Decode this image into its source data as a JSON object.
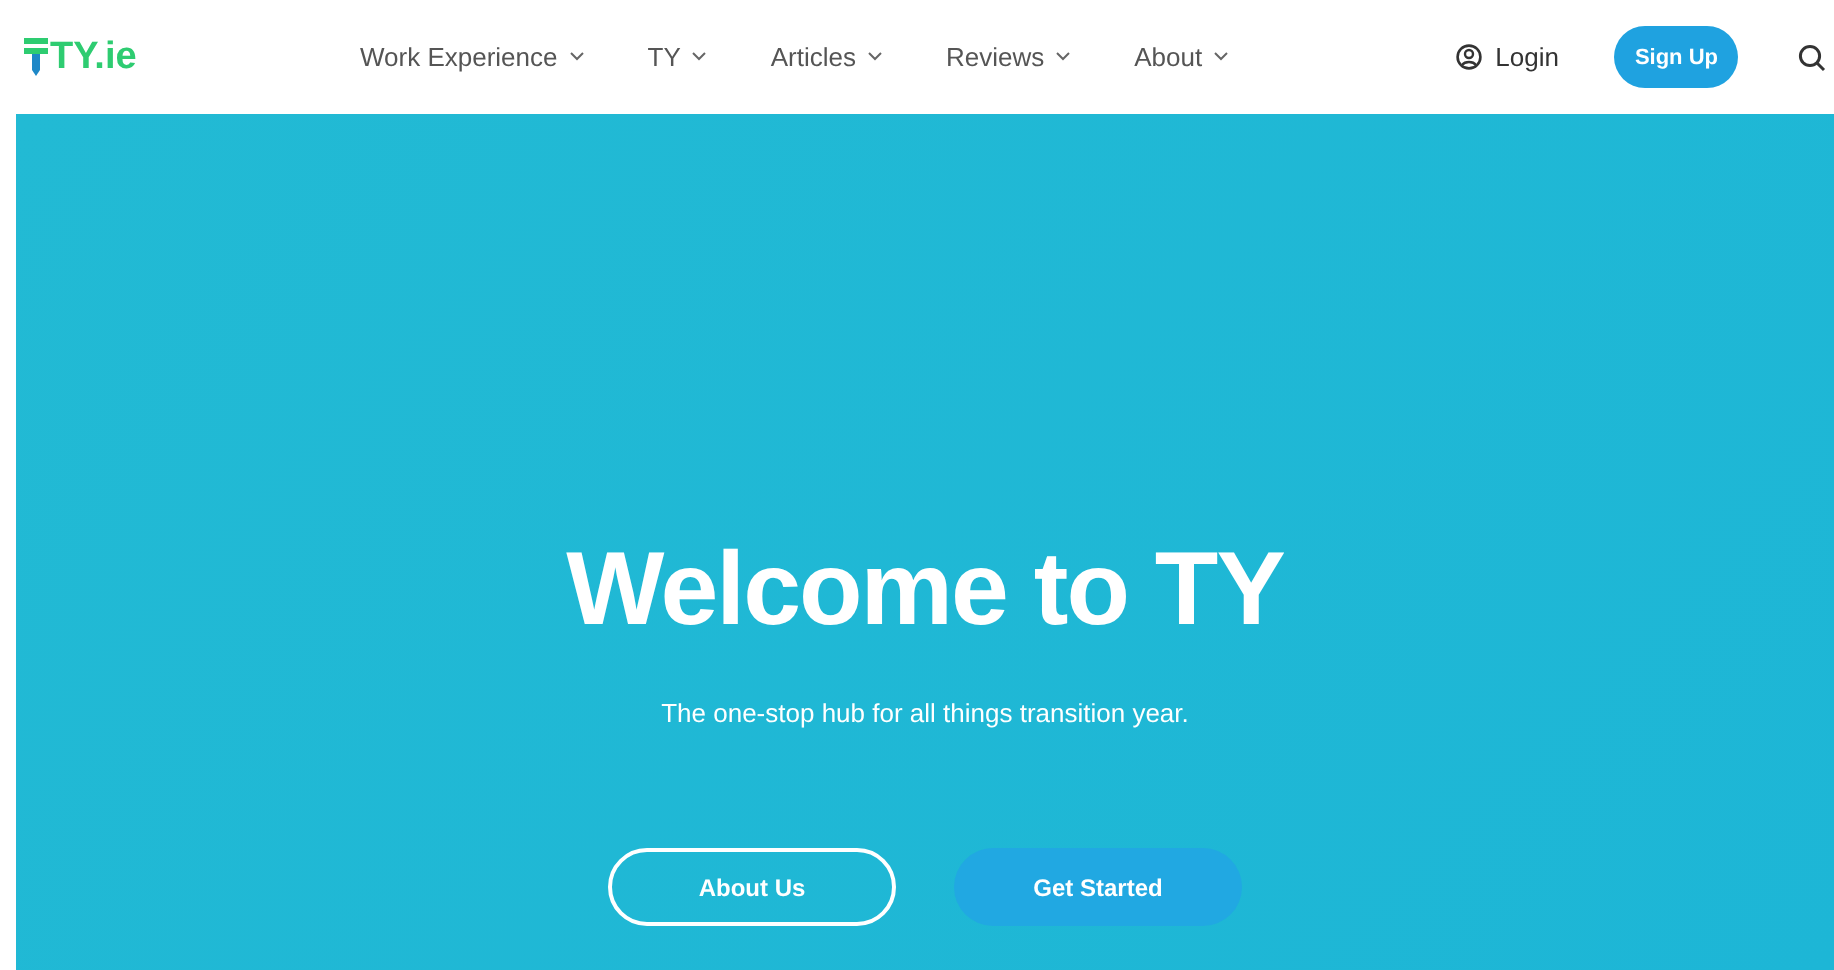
{
  "header": {
    "logo": "TY.ie",
    "nav": [
      {
        "label": "Work Experience"
      },
      {
        "label": "TY"
      },
      {
        "label": "Articles"
      },
      {
        "label": "Reviews"
      },
      {
        "label": "About"
      }
    ],
    "login": "Login",
    "signup": "Sign Up"
  },
  "hero": {
    "title": "Welcome to TY",
    "subtitle": "The one-stop hub for all things transition year.",
    "buttons": [
      {
        "label": "About Us",
        "kind": "outline"
      },
      {
        "label": "Get Started",
        "kind": "filled"
      }
    ]
  }
}
